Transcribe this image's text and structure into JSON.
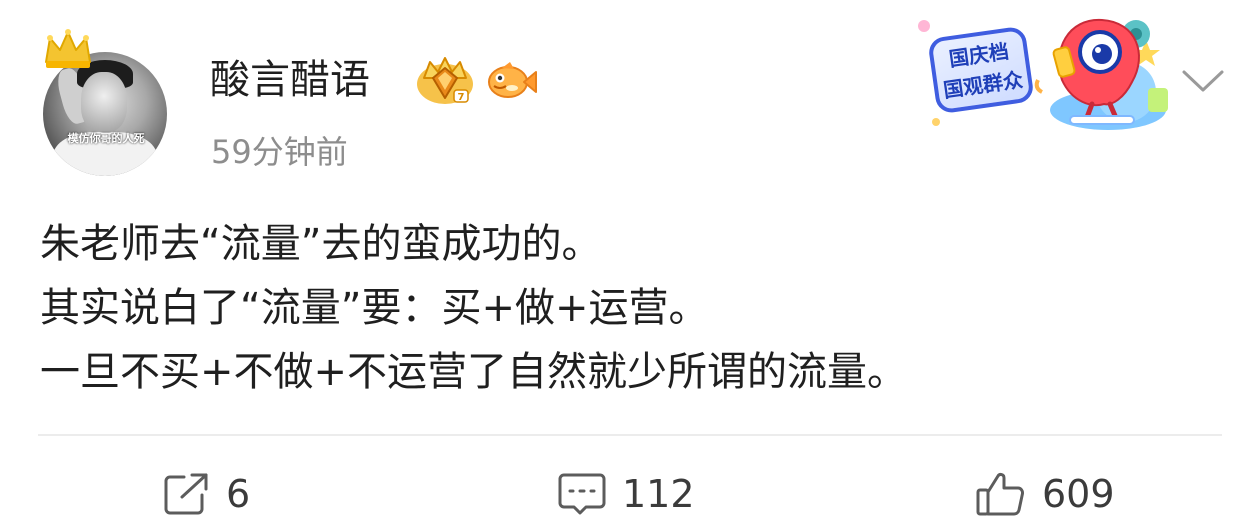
{
  "post": {
    "author": {
      "name": "酸言醋语",
      "avatar_caption": "模仿你哥的人死",
      "badges": [
        "vip-crown-badge",
        "fish-badge"
      ]
    },
    "timestamp": "59分钟前",
    "banner": {
      "line1": "国庆档",
      "line2": "国观群众"
    },
    "content": {
      "line1": "朱老师去“流量”去的蛮成功的。",
      "line2": "其实说白了“流量”要：买+做+运营。",
      "line3": "一旦不买+不做+不运营了自然就少所谓的流量。"
    },
    "actions": {
      "repost": {
        "icon": "share-icon",
        "count": "6"
      },
      "comment": {
        "icon": "comment-icon",
        "count": "112"
      },
      "like": {
        "icon": "thumbs-up-icon",
        "count": "609"
      }
    }
  },
  "colors": {
    "text_primary": "#1f1f1f",
    "text_secondary": "#8d8d8d",
    "action_text": "#3b3b3b",
    "divider": "#ececec",
    "banner_blue": "#3f5de0",
    "crown_yellow": "#f4c430",
    "background": "#ffffff"
  }
}
